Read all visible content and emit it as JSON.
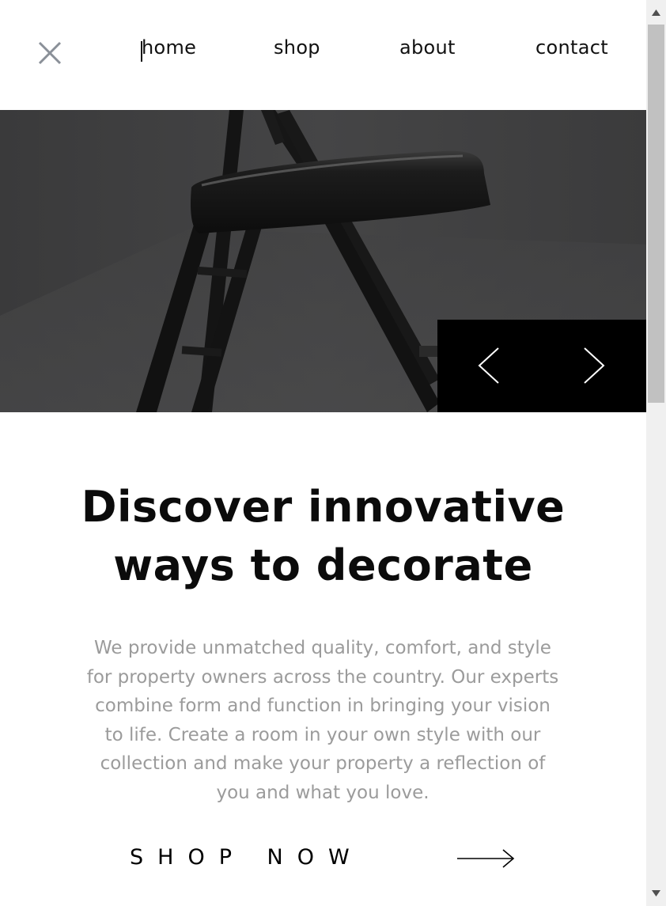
{
  "nav": {
    "close_icon": "close-icon",
    "items": [
      {
        "label": "home"
      },
      {
        "label": "shop"
      },
      {
        "label": "about"
      },
      {
        "label": "contact"
      }
    ]
  },
  "hero": {
    "image": "folding-chair-photo",
    "prev_icon": "chevron-left-icon",
    "next_icon": "chevron-right-icon"
  },
  "content": {
    "headline_line1": "Discover innovative",
    "headline_line2": "ways to decorate",
    "description": "We provide unmatched quality, comfort, and style for property owners across the country. Our experts combine form and function in bringing your vision to life. Create a room in your own style with our collection and make your property a reflection of you and what you love.",
    "cta_label": "SHOP NOW",
    "cta_icon": "arrow-right-icon"
  },
  "scrollbar": {
    "up_icon": "scroll-up-arrow-icon",
    "down_icon": "scroll-down-arrow-icon"
  },
  "colors": {
    "text": "#111111",
    "muted_text": "#9b9b9b",
    "slider_bg": "#000000",
    "hero_bg": "#3f3f40",
    "close_icon": "#8a9098"
  }
}
